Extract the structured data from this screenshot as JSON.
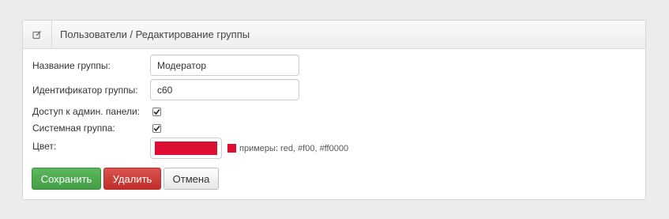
{
  "header": {
    "icon": "edit-icon",
    "breadcrumb": "Пользователи / Редактирование группы"
  },
  "form": {
    "name_label": "Название группы:",
    "name_value": "Модератор",
    "id_label": "Идентификатор группы:",
    "id_value": "c60",
    "admin_access_label": "Доступ к админ. панели:",
    "admin_access_checked": true,
    "system_group_label": "Системная группа:",
    "system_group_checked": true,
    "color_label": "Цвет:",
    "color_value": "#dc0f32",
    "color_hint": "примеры: red, #f00, #ff0000"
  },
  "buttons": {
    "save": "Сохранить",
    "delete": "Удалить",
    "cancel": "Отмена"
  },
  "colors": {
    "save": "#5cb85c",
    "delete": "#d9534f",
    "cancel": "#ffffff"
  }
}
